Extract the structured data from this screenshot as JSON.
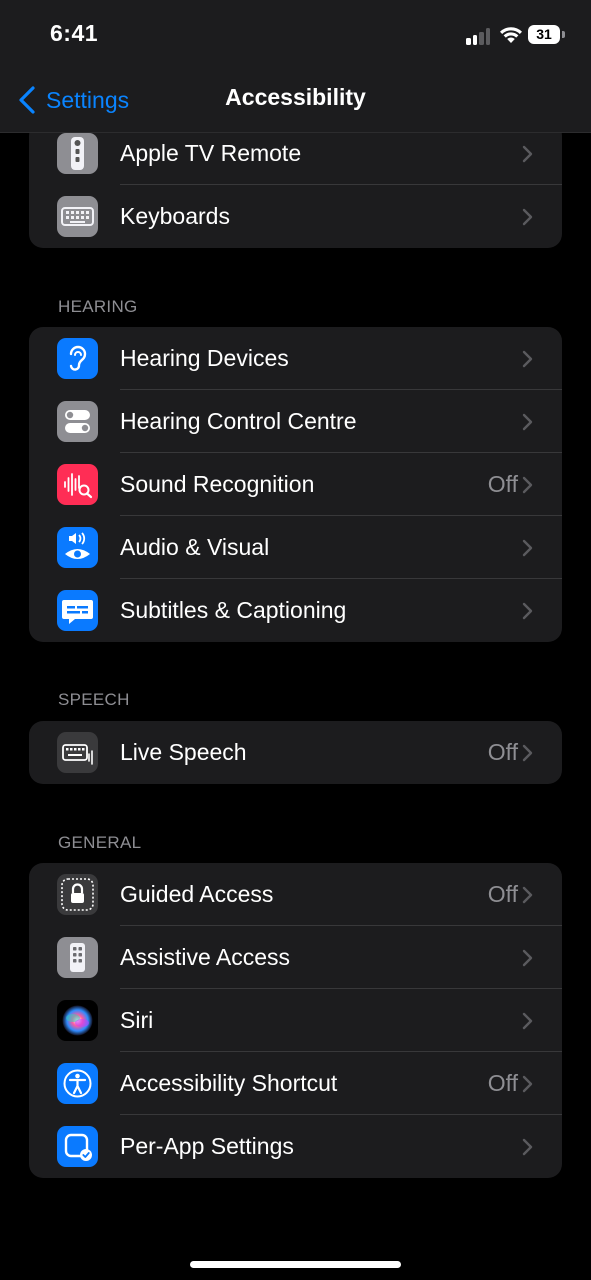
{
  "status": {
    "time": "6:41",
    "battery": "31"
  },
  "nav": {
    "back_label": "Settings",
    "title": "Accessibility"
  },
  "groups": {
    "top": [
      {
        "label": "Apple TV Remote",
        "value": "",
        "icon": "tv-remote-icon",
        "icon_color": "#8e8e93"
      },
      {
        "label": "Keyboards",
        "value": "",
        "icon": "keyboard-icon",
        "icon_color": "#8e8e93"
      }
    ],
    "hearing": {
      "header": "HEARING",
      "items": [
        {
          "label": "Hearing Devices",
          "value": "",
          "icon": "ear-icon",
          "icon_color": "#0a7aff"
        },
        {
          "label": "Hearing Control Centre",
          "value": "",
          "icon": "toggles-icon",
          "icon_color": "#8e8e93"
        },
        {
          "label": "Sound Recognition",
          "value": "Off",
          "icon": "sound-recognition-icon",
          "icon_color": "#ff2d55"
        },
        {
          "label": "Audio & Visual",
          "value": "",
          "icon": "audio-visual-icon",
          "icon_color": "#0a7aff"
        },
        {
          "label": "Subtitles & Captioning",
          "value": "",
          "icon": "subtitles-icon",
          "icon_color": "#0a7aff"
        }
      ]
    },
    "speech": {
      "header": "SPEECH",
      "items": [
        {
          "label": "Live Speech",
          "value": "Off",
          "icon": "live-speech-icon",
          "icon_color": "#3a3a3c"
        }
      ]
    },
    "general": {
      "header": "GENERAL",
      "items": [
        {
          "label": "Guided Access",
          "value": "Off",
          "icon": "lock-icon",
          "icon_color": "#3a3a3c"
        },
        {
          "label": "Assistive Access",
          "value": "",
          "icon": "assistive-access-icon",
          "icon_color": "#8e8e93"
        },
        {
          "label": "Siri",
          "value": "",
          "icon": "siri-icon",
          "icon_color": "#000000"
        },
        {
          "label": "Accessibility Shortcut",
          "value": "Off",
          "icon": "accessibility-icon",
          "icon_color": "#0a7aff"
        },
        {
          "label": "Per-App Settings",
          "value": "",
          "icon": "per-app-icon",
          "icon_color": "#0a7aff"
        }
      ]
    }
  }
}
